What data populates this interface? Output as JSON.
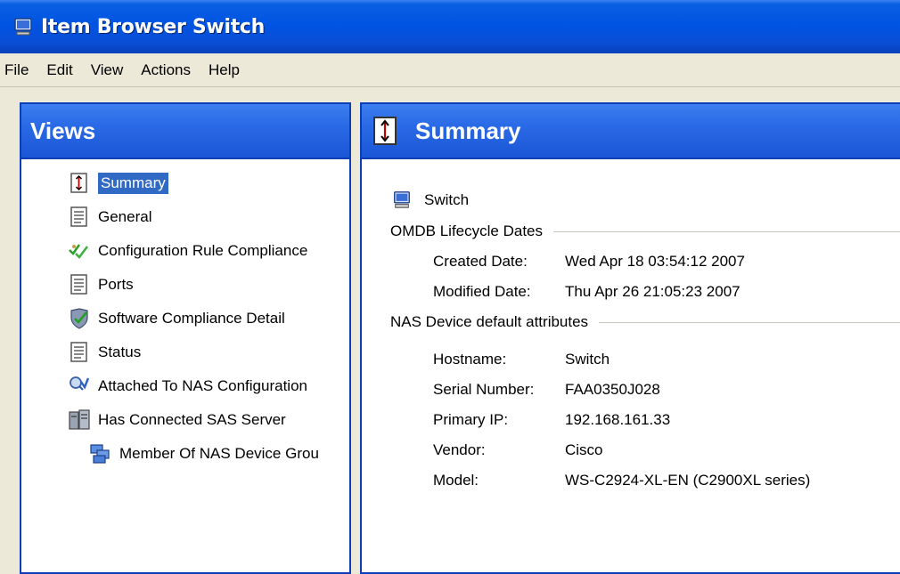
{
  "window": {
    "title": "Item Browser Switch",
    "icon": "computer-icon"
  },
  "menu": [
    "File",
    "Edit",
    "View",
    "Actions",
    "Help"
  ],
  "views_panel": {
    "title": "Views",
    "items": [
      {
        "label": "Summary",
        "icon": "summary-icon",
        "selected": true
      },
      {
        "label": "General",
        "icon": "document-icon"
      },
      {
        "label": "Configuration Rule Compliance",
        "icon": "checkmarks-icon"
      },
      {
        "label": "Ports",
        "icon": "document-icon"
      },
      {
        "label": "Software Compliance Detail",
        "icon": "shield-check-icon"
      },
      {
        "label": "Status",
        "icon": "document-icon"
      },
      {
        "label": "Attached To NAS Configuration",
        "icon": "config-search-icon"
      },
      {
        "label": "Has Connected SAS Server",
        "icon": "server-icon"
      },
      {
        "label": "Member Of NAS Device Grou",
        "icon": "device-group-icon"
      }
    ]
  },
  "summary_panel": {
    "title": "Summary",
    "entity": "Switch",
    "groups": [
      {
        "title": "OMDB Lifecycle Dates",
        "fields": [
          {
            "label": "Created Date:",
            "value": "Wed Apr 18 03:54:12 2007"
          },
          {
            "label": "Modified Date:",
            "value": "Thu Apr 26 21:05:23 2007"
          }
        ]
      },
      {
        "title": "NAS Device default attributes",
        "fields": [
          {
            "label": "Hostname:",
            "value": "Switch"
          },
          {
            "label": "Serial Number:",
            "value": "FAA0350J028"
          },
          {
            "label": "Primary IP:",
            "value": "192.168.161.33"
          },
          {
            "label": "Vendor:",
            "value": "Cisco"
          },
          {
            "label": "Model:",
            "value": "WS-C2924-XL-EN (C2900XL series)"
          }
        ]
      }
    ]
  },
  "colors": {
    "titlebar": "#0054e3",
    "panel_header": "#2b6ae6",
    "selection": "#316ac5",
    "chrome": "#ece9d8"
  }
}
